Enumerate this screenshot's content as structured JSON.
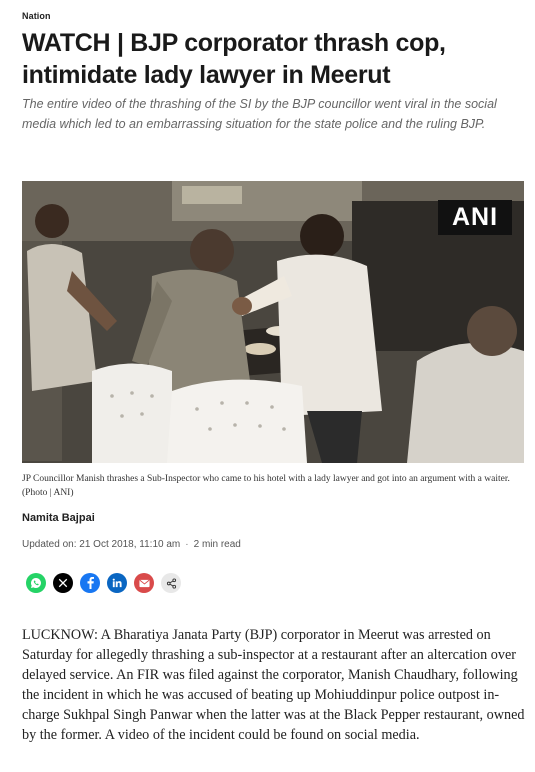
{
  "article": {
    "section": "Nation",
    "headline": "WATCH | BJP corporator thrash cop, intimidate lady lawyer in Meerut",
    "subhead": "The entire video of the thrashing of the SI by the BJP councillor went viral in the social media which led to an embarrassing situation for the state police and the ruling BJP.",
    "image": {
      "watermark": "ANI",
      "caption": "JP Councillor Manish thrashes a Sub-Inspector who came to his hotel with a lady lawyer and got into an argument with a waiter. (Photo | ANI)"
    },
    "author": "Namita Bajpai",
    "updated": "Updated on: 21 Oct 2018, 11:10 am",
    "separator": "·",
    "read_time": "2 min read",
    "share": [
      {
        "name": "whatsapp",
        "icon": "whatsapp-icon",
        "color": "#25D366"
      },
      {
        "name": "x",
        "icon": "x-icon",
        "color": "#000000"
      },
      {
        "name": "facebook",
        "icon": "facebook-icon",
        "color": "#1877F2"
      },
      {
        "name": "linkedin",
        "icon": "linkedin-icon",
        "color": "#0A66C2"
      },
      {
        "name": "email",
        "icon": "mail-icon",
        "color": "#D94A4A"
      },
      {
        "name": "more",
        "icon": "share-icon",
        "color": "#E8E8E8"
      }
    ],
    "body": "LUCKNOW: A Bharatiya Janata Party (BJP) corporator in Meerut was arrested on Saturday for allegedly thrashing a sub-inspector at a restaurant after an altercation over delayed service. An FIR was filed against the corporator, Manish Chaudhary, following the incident in which he was accused of beating up Mohiuddinpur police outpost in-charge Sukhpal Singh Panwar when the latter was at the Black Pepper restaurant, owned by the former. A video of the incident could be found on social media."
  }
}
